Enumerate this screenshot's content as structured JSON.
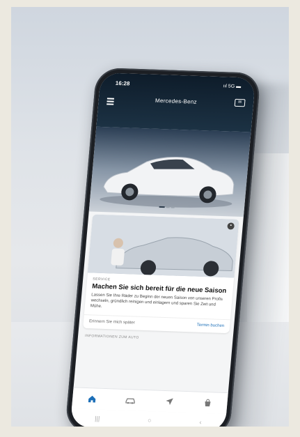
{
  "status": {
    "time": "16:28",
    "signal": "ııl 5G ▬"
  },
  "header": {
    "brand": "Mercedes-Benz"
  },
  "hero": {
    "car_color": "#f2f3f5"
  },
  "card": {
    "eyebrow": "SERVICE",
    "title": "Machen Sie sich bereit für die neue Saison",
    "text": "Lassen Sie Ihre Räder zu Beginn der neuen Saison von unseren Profis wechseln, gründlich reinigen und einlagern und sparen Sie Zeit und Mühe.",
    "secondary_action": "Erinnern Sie mich später",
    "primary_action": "Termin buchen"
  },
  "section_label": "INFORMATIONEN ZUM AUTO",
  "tabs": [
    {
      "icon": "home-icon",
      "active": true
    },
    {
      "icon": "car-icon",
      "active": false
    },
    {
      "icon": "navigation-icon",
      "active": false
    },
    {
      "icon": "shop-icon",
      "active": false
    }
  ],
  "colors": {
    "accent": "#1c6fb8",
    "header_bg": "#0e1c2a"
  }
}
